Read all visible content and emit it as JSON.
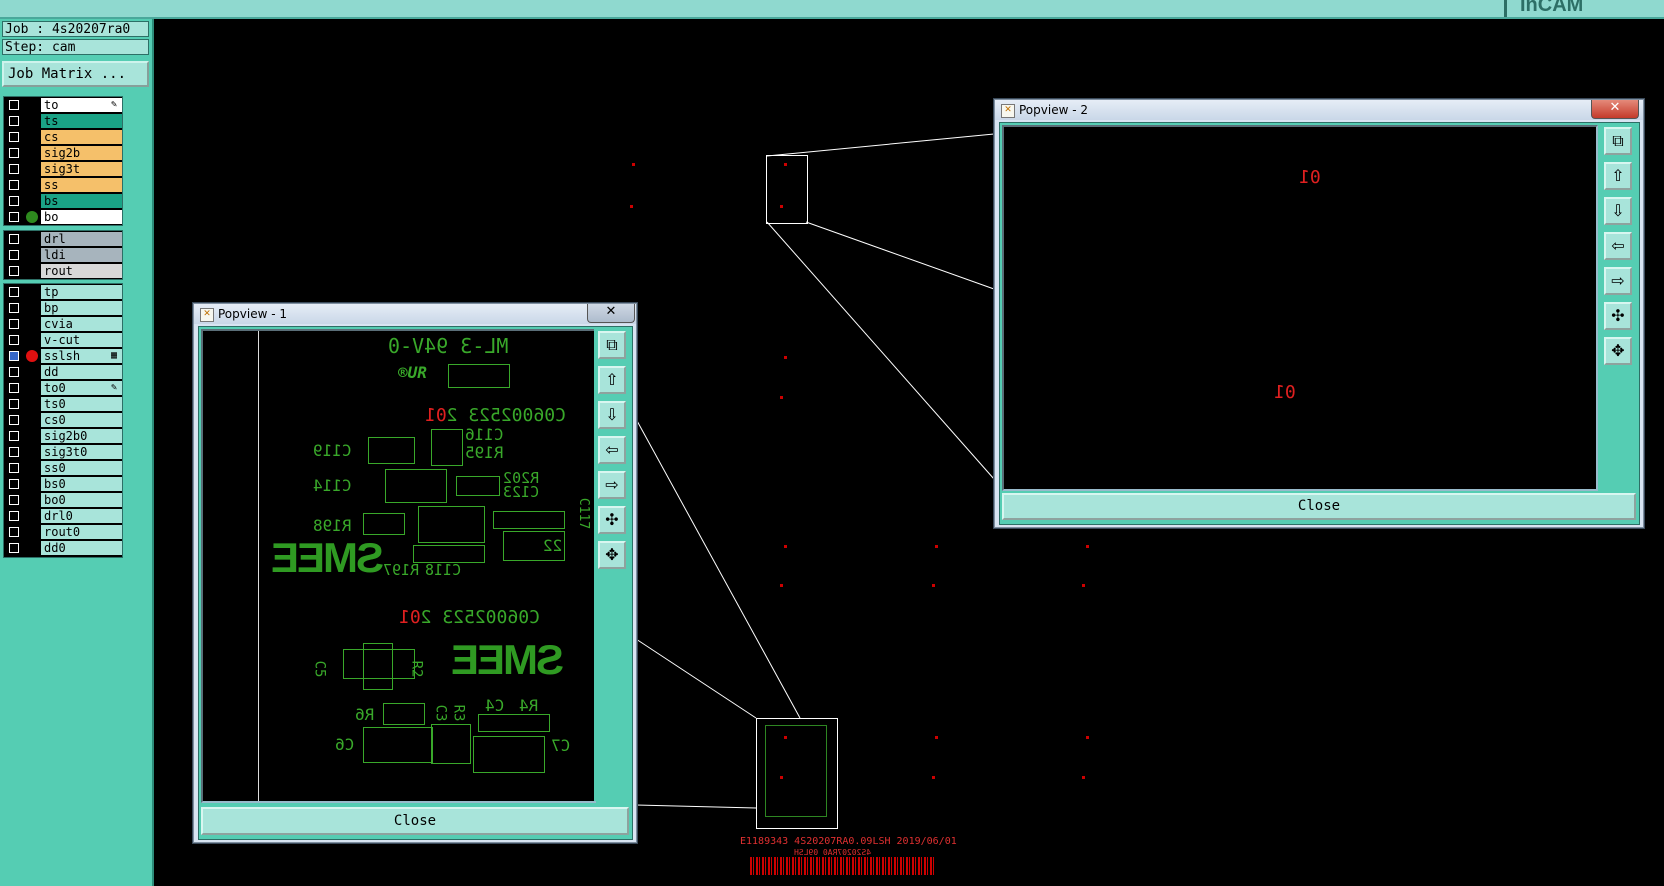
{
  "app": {
    "brand": "InCAM"
  },
  "job_info": {
    "job": "Job : 4s20207ra0",
    "step": "Step: cam",
    "job_matrix_button": "Job Matrix ..."
  },
  "layers": {
    "group1": [
      {
        "name": "to",
        "color": "#ffffff",
        "icon": "edit-icon"
      },
      {
        "name": "ts",
        "color": "#1aa386"
      },
      {
        "name": "cs",
        "color": "#f5c06a"
      },
      {
        "name": "sig2b",
        "color": "#f5c06a"
      },
      {
        "name": "sig3t",
        "color": "#f5c06a"
      },
      {
        "name": "ss",
        "color": "#f5c06a"
      },
      {
        "name": "bs",
        "color": "#1aa386"
      },
      {
        "name": "bo",
        "color": "#ffffff",
        "active_dot": "#2e8a1e"
      }
    ],
    "group2": [
      {
        "name": "drl",
        "color": "#a7b4bd"
      },
      {
        "name": "ldi",
        "color": "#a7b4bd"
      },
      {
        "name": "rout",
        "color": "#d8d8d8"
      }
    ],
    "group3": [
      {
        "name": "tp",
        "color": "#a8e4da"
      },
      {
        "name": "bp",
        "color": "#a8e4da"
      },
      {
        "name": "cvia",
        "color": "#a8e4da"
      },
      {
        "name": "v-cut",
        "color": "#a8e4da"
      },
      {
        "name": "sslsh",
        "color": "#a8e4da",
        "active_dot": "#e01010",
        "selected": true,
        "icon": "grid-icon"
      },
      {
        "name": "dd",
        "color": "#a8e4da"
      },
      {
        "name": "to0",
        "color": "#a8e4da",
        "icon": "edit-icon"
      },
      {
        "name": "ts0",
        "color": "#a8e4da"
      },
      {
        "name": "cs0",
        "color": "#a8e4da"
      },
      {
        "name": "sig2b0",
        "color": "#a8e4da"
      },
      {
        "name": "sig3t0",
        "color": "#a8e4da"
      },
      {
        "name": "ss0",
        "color": "#a8e4da"
      },
      {
        "name": "bs0",
        "color": "#a8e4da"
      },
      {
        "name": "bo0",
        "color": "#a8e4da"
      },
      {
        "name": "drl0",
        "color": "#a8e4da"
      },
      {
        "name": "rout0",
        "color": "#a8e4da"
      },
      {
        "name": "dd0",
        "color": "#a8e4da"
      }
    ]
  },
  "popview1": {
    "title": "Popview - 1",
    "close_label": "Close",
    "board": {
      "marking": "ML-3 94V-0",
      "logo": "SMEE",
      "code1": "C06002523 2",
      "code1_red": "01",
      "code2": "C06002523 2",
      "code2_red": "01",
      "refdes": [
        "C119",
        "C116",
        "R195",
        "C114",
        "R202",
        "C123",
        "C117",
        "R198",
        "R197",
        "C118",
        "C5",
        "C3",
        "R2",
        "R6",
        "C3",
        "R3",
        "R4",
        "C4",
        "C6",
        "C7",
        "22"
      ]
    }
  },
  "popview2": {
    "title": "Popview - 2",
    "close_label": "Close",
    "labels": [
      "01",
      "01"
    ]
  },
  "canvas": {
    "bottom_text": "E1189343  4S20207RA0.09LSH   2019/06/01",
    "bottom_text2": "4S20207RA0 09LSH"
  },
  "colors": {
    "panel": "#55cdb3",
    "silk": "#39a82a",
    "marker": "#cc0000"
  }
}
